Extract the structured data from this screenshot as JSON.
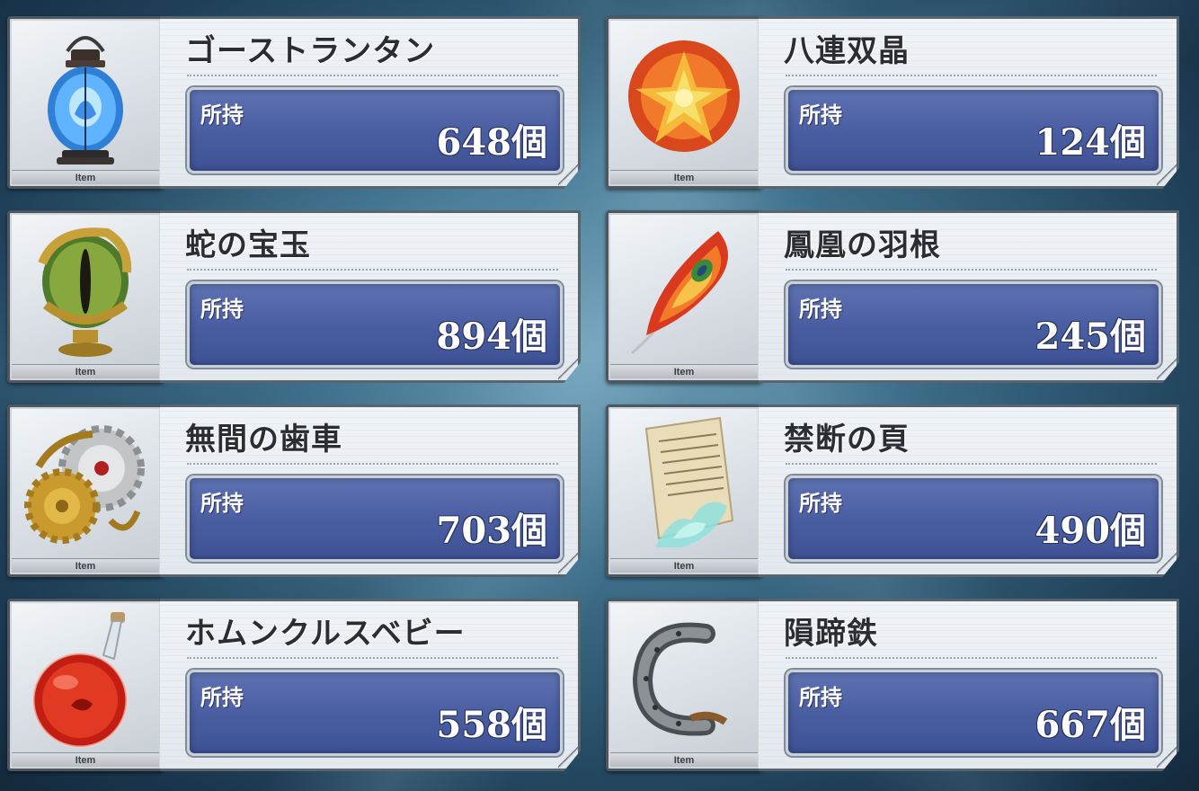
{
  "items": [
    {
      "name": "ゴーストランタン",
      "own_label": "所持",
      "count": "648個",
      "tag": "Item",
      "icon": "ghost-lantern-icon"
    },
    {
      "name": "八連双晶",
      "own_label": "所持",
      "count": "124個",
      "tag": "Item",
      "icon": "octuplet-crystals-icon"
    },
    {
      "name": "蛇の宝玉",
      "own_label": "所持",
      "count": "894個",
      "tag": "Item",
      "icon": "serpent-jewel-icon"
    },
    {
      "name": "鳳凰の羽根",
      "own_label": "所持",
      "count": "245個",
      "tag": "Item",
      "icon": "phoenix-feather-icon"
    },
    {
      "name": "無間の歯車",
      "own_label": "所持",
      "count": "703個",
      "tag": "Item",
      "icon": "eternal-gear-icon"
    },
    {
      "name": "禁断の頁",
      "own_label": "所持",
      "count": "490個",
      "tag": "Item",
      "icon": "forbidden-page-icon"
    },
    {
      "name": "ホムンクルスベビー",
      "own_label": "所持",
      "count": "558個",
      "tag": "Item",
      "icon": "homunculus-baby-icon"
    },
    {
      "name": "隕蹄鉄",
      "own_label": "所持",
      "count": "667個",
      "tag": "Item",
      "icon": "meteor-horseshoe-icon"
    }
  ],
  "colors": {
    "count_box": "#4a5ea2",
    "panel": "#e3e8ed",
    "border": "#5a646e"
  }
}
